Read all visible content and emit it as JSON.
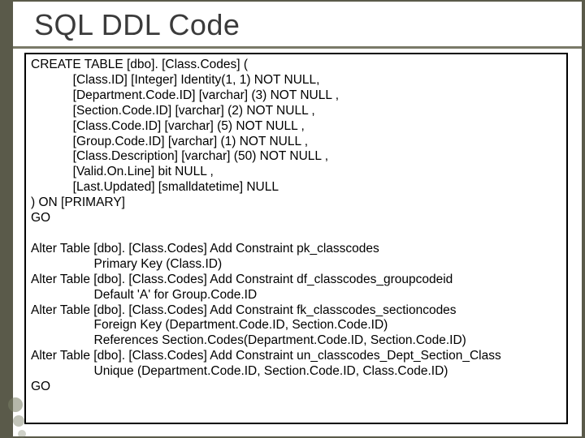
{
  "slide": {
    "title": "SQL DDL Code"
  },
  "code": {
    "block1": "CREATE TABLE [dbo]. [Class.Codes] (\n            [Class.ID] [Integer] Identity(1, 1) NOT NULL,\n            [Department.Code.ID] [varchar] (3) NOT NULL ,\n            [Section.Code.ID] [varchar] (2) NOT NULL ,\n            [Class.Code.ID] [varchar] (5) NOT NULL ,\n            [Group.Code.ID] [varchar] (1) NOT NULL ,\n            [Class.Description] [varchar] (50) NOT NULL ,\n            [Valid.On.Line] bit NULL ,\n            [Last.Updated] [smalldatetime] NULL\n) ON [PRIMARY]\nGO",
    "block2": "Alter Table [dbo]. [Class.Codes] Add Constraint pk_classcodes\n                  Primary Key (Class.ID)\nAlter Table [dbo]. [Class.Codes] Add Constraint df_classcodes_groupcodeid\n                  Default 'A' for Group.Code.ID\nAlter Table [dbo]. [Class.Codes] Add Constraint fk_classcodes_sectioncodes\n                  Foreign Key (Department.Code.ID, Section.Code.ID)\n                  References Section.Codes(Department.Code.ID, Section.Code.ID)\nAlter Table [dbo]. [Class.Codes] Add Constraint un_classcodes_Dept_Section_Class\n                  Unique (Department.Code.ID, Section.Code.ID, Class.Code.ID)\nGO"
  }
}
